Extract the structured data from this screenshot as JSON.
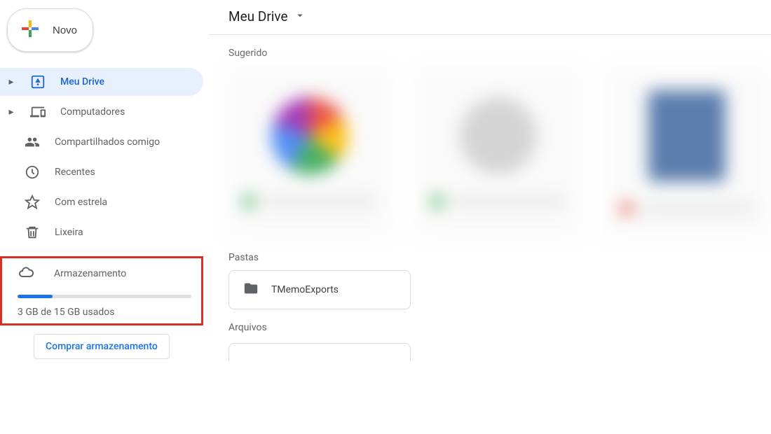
{
  "sidebar": {
    "new_label": "Novo",
    "items": [
      {
        "label": "Meu Drive"
      },
      {
        "label": "Computadores"
      },
      {
        "label": "Compartilhados comigo"
      },
      {
        "label": "Recentes"
      },
      {
        "label": "Com estrela"
      },
      {
        "label": "Lixeira"
      }
    ],
    "storage": {
      "label": "Armazenamento",
      "usage_text": "3 GB de 15 GB usados",
      "percent": 20,
      "buy_label": "Comprar armazenamento"
    }
  },
  "main": {
    "breadcrumb": "Meu Drive",
    "sections": {
      "suggested": "Sugerido",
      "folders": "Pastas",
      "files": "Arquivos"
    },
    "folders": [
      {
        "name": "TMemoExports"
      }
    ]
  }
}
